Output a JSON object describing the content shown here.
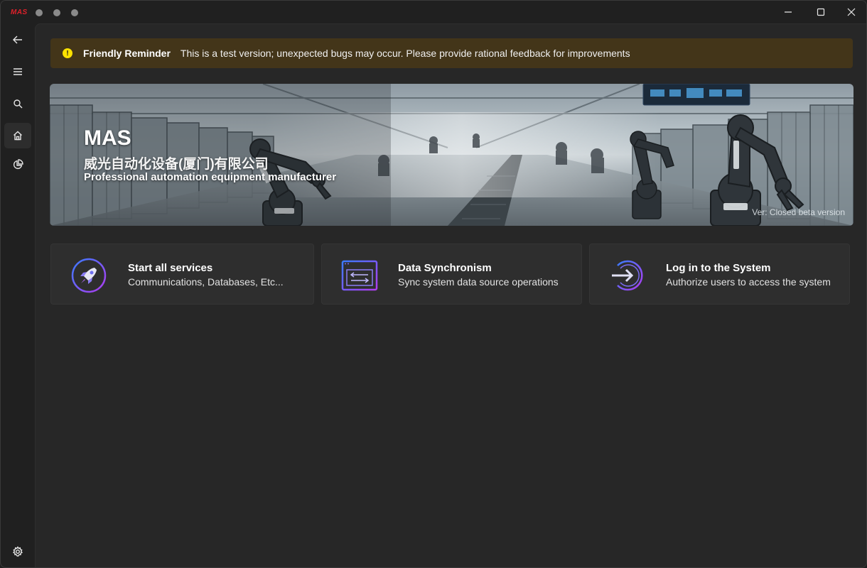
{
  "titlebar": {
    "app_logo": "MAS",
    "icons": [
      "minimize-icon",
      "maximize-icon",
      "close-icon"
    ]
  },
  "sidebar": {
    "items": [
      {
        "name": "back",
        "icon": "arrow-left-icon"
      },
      {
        "name": "menu",
        "icon": "hamburger-icon"
      },
      {
        "name": "search",
        "icon": "search-icon"
      },
      {
        "name": "home",
        "icon": "home-icon",
        "active": true
      },
      {
        "name": "dashboard",
        "icon": "pie-chart-icon"
      },
      {
        "name": "settings",
        "icon": "gear-icon"
      }
    ]
  },
  "reminder": {
    "title": "Friendly Reminder",
    "text": "This is a test version; unexpected bugs may occur. Please provide rational feedback for improvements",
    "icon": "warning-icon",
    "color": "#433519"
  },
  "banner": {
    "title": "MAS",
    "company_cn": "威光自动化设备(厦门)有限公司",
    "subtitle": "Professional automation equipment manufacturer",
    "version": "Ver: Closed beta version"
  },
  "cards": [
    {
      "title": "Start all services",
      "desc": "Communications, Databases, Etc...",
      "icon": "rocket-icon"
    },
    {
      "title": "Data Synchronism",
      "desc": "Sync system data source operations",
      "icon": "sync-window-icon"
    },
    {
      "title": "Log in to the System",
      "desc": "Authorize users to access the system",
      "icon": "login-icon"
    }
  ],
  "colors": {
    "accent_blue": "#3a7bff",
    "accent_purple": "#9b3cf0",
    "warning": "#fce100"
  }
}
